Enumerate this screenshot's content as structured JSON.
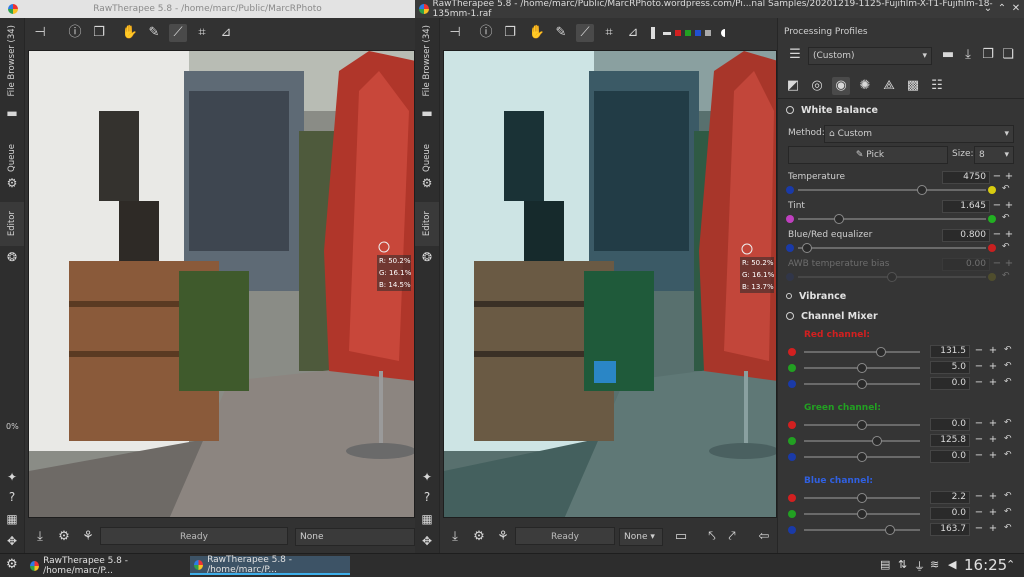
{
  "window_left": {
    "title": "RawTherapee 5.8 - /home/marc/Public/MarcRPhoto",
    "side_tabs": [
      "File Browser (34)",
      "Queue",
      "Editor"
    ],
    "zoom_percent": "0%",
    "status": "Ready",
    "preset": "None",
    "picker": {
      "r": "R: 50.2%",
      "g": "G: 16.1%",
      "b": "B: 14.5%"
    }
  },
  "window_right": {
    "title": "RawTherapee 5.8 - /home/marc/Public/MarcRPhoto.wordpress.com/Pi...nal Samples/20201219-1125-Fujifilm-X-T1-Fujifilm-18-135mm-1.raf",
    "side_tabs": [
      "File Browser (34)",
      "Queue",
      "Editor"
    ],
    "status": "Ready",
    "preset": "None",
    "picker": {
      "r": "R: 50.2%",
      "g": "G: 16.1%",
      "b": "B: 13.7%"
    }
  },
  "processing_profiles": {
    "heading": "Processing Profiles",
    "profile": "(Custom)"
  },
  "white_balance": {
    "title": "White Balance",
    "method_label": "Method:",
    "method_value": "Custom",
    "pick_label": "Pick",
    "size_label": "Size:",
    "size_value": "8",
    "sliders": [
      {
        "label": "Temperature",
        "value": "4750",
        "pos": 0.66,
        "left": "#1a3aa8",
        "right": "#d8cc10"
      },
      {
        "label": "Tint",
        "value": "1.645",
        "pos": 0.22,
        "left": "#c040c0",
        "right": "#22b022"
      },
      {
        "label": "Blue/Red equalizer",
        "value": "0.800",
        "pos": 0.05,
        "left": "#1a3aa8",
        "right": "#c82020"
      },
      {
        "label": "AWB temperature bias",
        "value": "0.00",
        "pos": 0.5,
        "left": "#2a3a70",
        "right": "#807a20"
      }
    ]
  },
  "vibrance": {
    "title": "Vibrance"
  },
  "channel_mixer": {
    "title": "Channel Mixer",
    "groups": [
      {
        "label": "Red channel:",
        "color": "#d22020",
        "rows": [
          {
            "value": "131.5",
            "pos": 0.66,
            "dot": "#d22020"
          },
          {
            "value": "5.0",
            "pos": 0.5,
            "dot": "#22a022"
          },
          {
            "value": "0.0",
            "pos": 0.5,
            "dot": "#1a3aa8"
          }
        ]
      },
      {
        "label": "Green channel:",
        "color": "#22a022",
        "rows": [
          {
            "value": "0.0",
            "pos": 0.5,
            "dot": "#d22020"
          },
          {
            "value": "125.8",
            "pos": 0.63,
            "dot": "#22a022"
          },
          {
            "value": "0.0",
            "pos": 0.5,
            "dot": "#1a3aa8"
          }
        ]
      },
      {
        "label": "Blue channel:",
        "color": "#3060e0",
        "rows": [
          {
            "value": "2.2",
            "pos": 0.5,
            "dot": "#d22020"
          },
          {
            "value": "0.0",
            "pos": 0.5,
            "dot": "#22a022"
          },
          {
            "value": "163.7",
            "pos": 0.74,
            "dot": "#1a3aa8"
          }
        ]
      }
    ]
  },
  "taskbar": {
    "tasks": [
      "RawTherapee 5.8 - /home/marc/P...",
      "RawTherapee 5.8 - /home/marc/P..."
    ],
    "time": "16:25"
  },
  "colors": {
    "accent": "#3daee9",
    "panel_bg": "#353535",
    "umbrella": "#b0362a"
  }
}
